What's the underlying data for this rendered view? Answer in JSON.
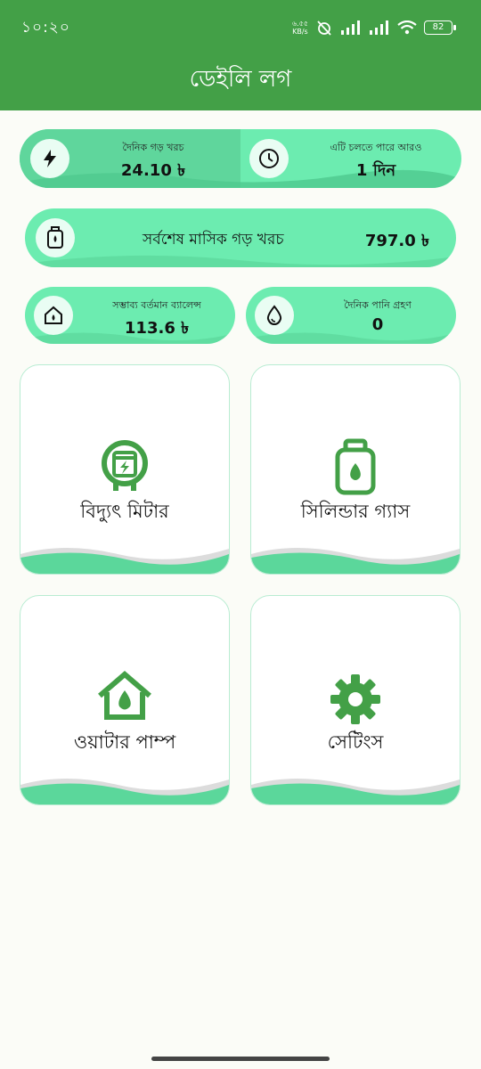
{
  "status_bar": {
    "time": "১০:২০",
    "net_speed_top": "৬.৫৫",
    "net_speed_unit": "KB/s",
    "battery": "82"
  },
  "app_bar": {
    "title": "ডেইলি লগ"
  },
  "stats": {
    "daily_avg_cost": {
      "label": "দৈনিক গড় খরচ",
      "value": "24.10 ৳"
    },
    "remaining": {
      "label": "এটি চলতে পারে আরও",
      "value": "1 দিন"
    },
    "last_monthly_avg": {
      "label": "সর্বশেষ মাসিক গড় খরচ",
      "value": "797.0 ৳"
    },
    "possible_balance": {
      "label": "সম্ভাব্য বর্তমান ব্যালেন্স",
      "value": "113.6 ৳"
    },
    "daily_water": {
      "label": "দৈনিক পানি গ্রহণ",
      "value": "0"
    }
  },
  "cards": [
    {
      "label": "বিদ্যুৎ মিটার",
      "icon": "electric-meter-icon"
    },
    {
      "label": "সিলিন্ডার গ্যাস",
      "icon": "gas-cylinder-icon"
    },
    {
      "label": "ওয়াটার পাম্প",
      "icon": "water-pump-icon"
    },
    {
      "label": "সেটিংস",
      "icon": "gear-icon"
    }
  ],
  "colors": {
    "app_bar": "#43a047",
    "pill": "#6cecb0",
    "icon_green": "#43a047",
    "background": "#fbfcf7"
  }
}
